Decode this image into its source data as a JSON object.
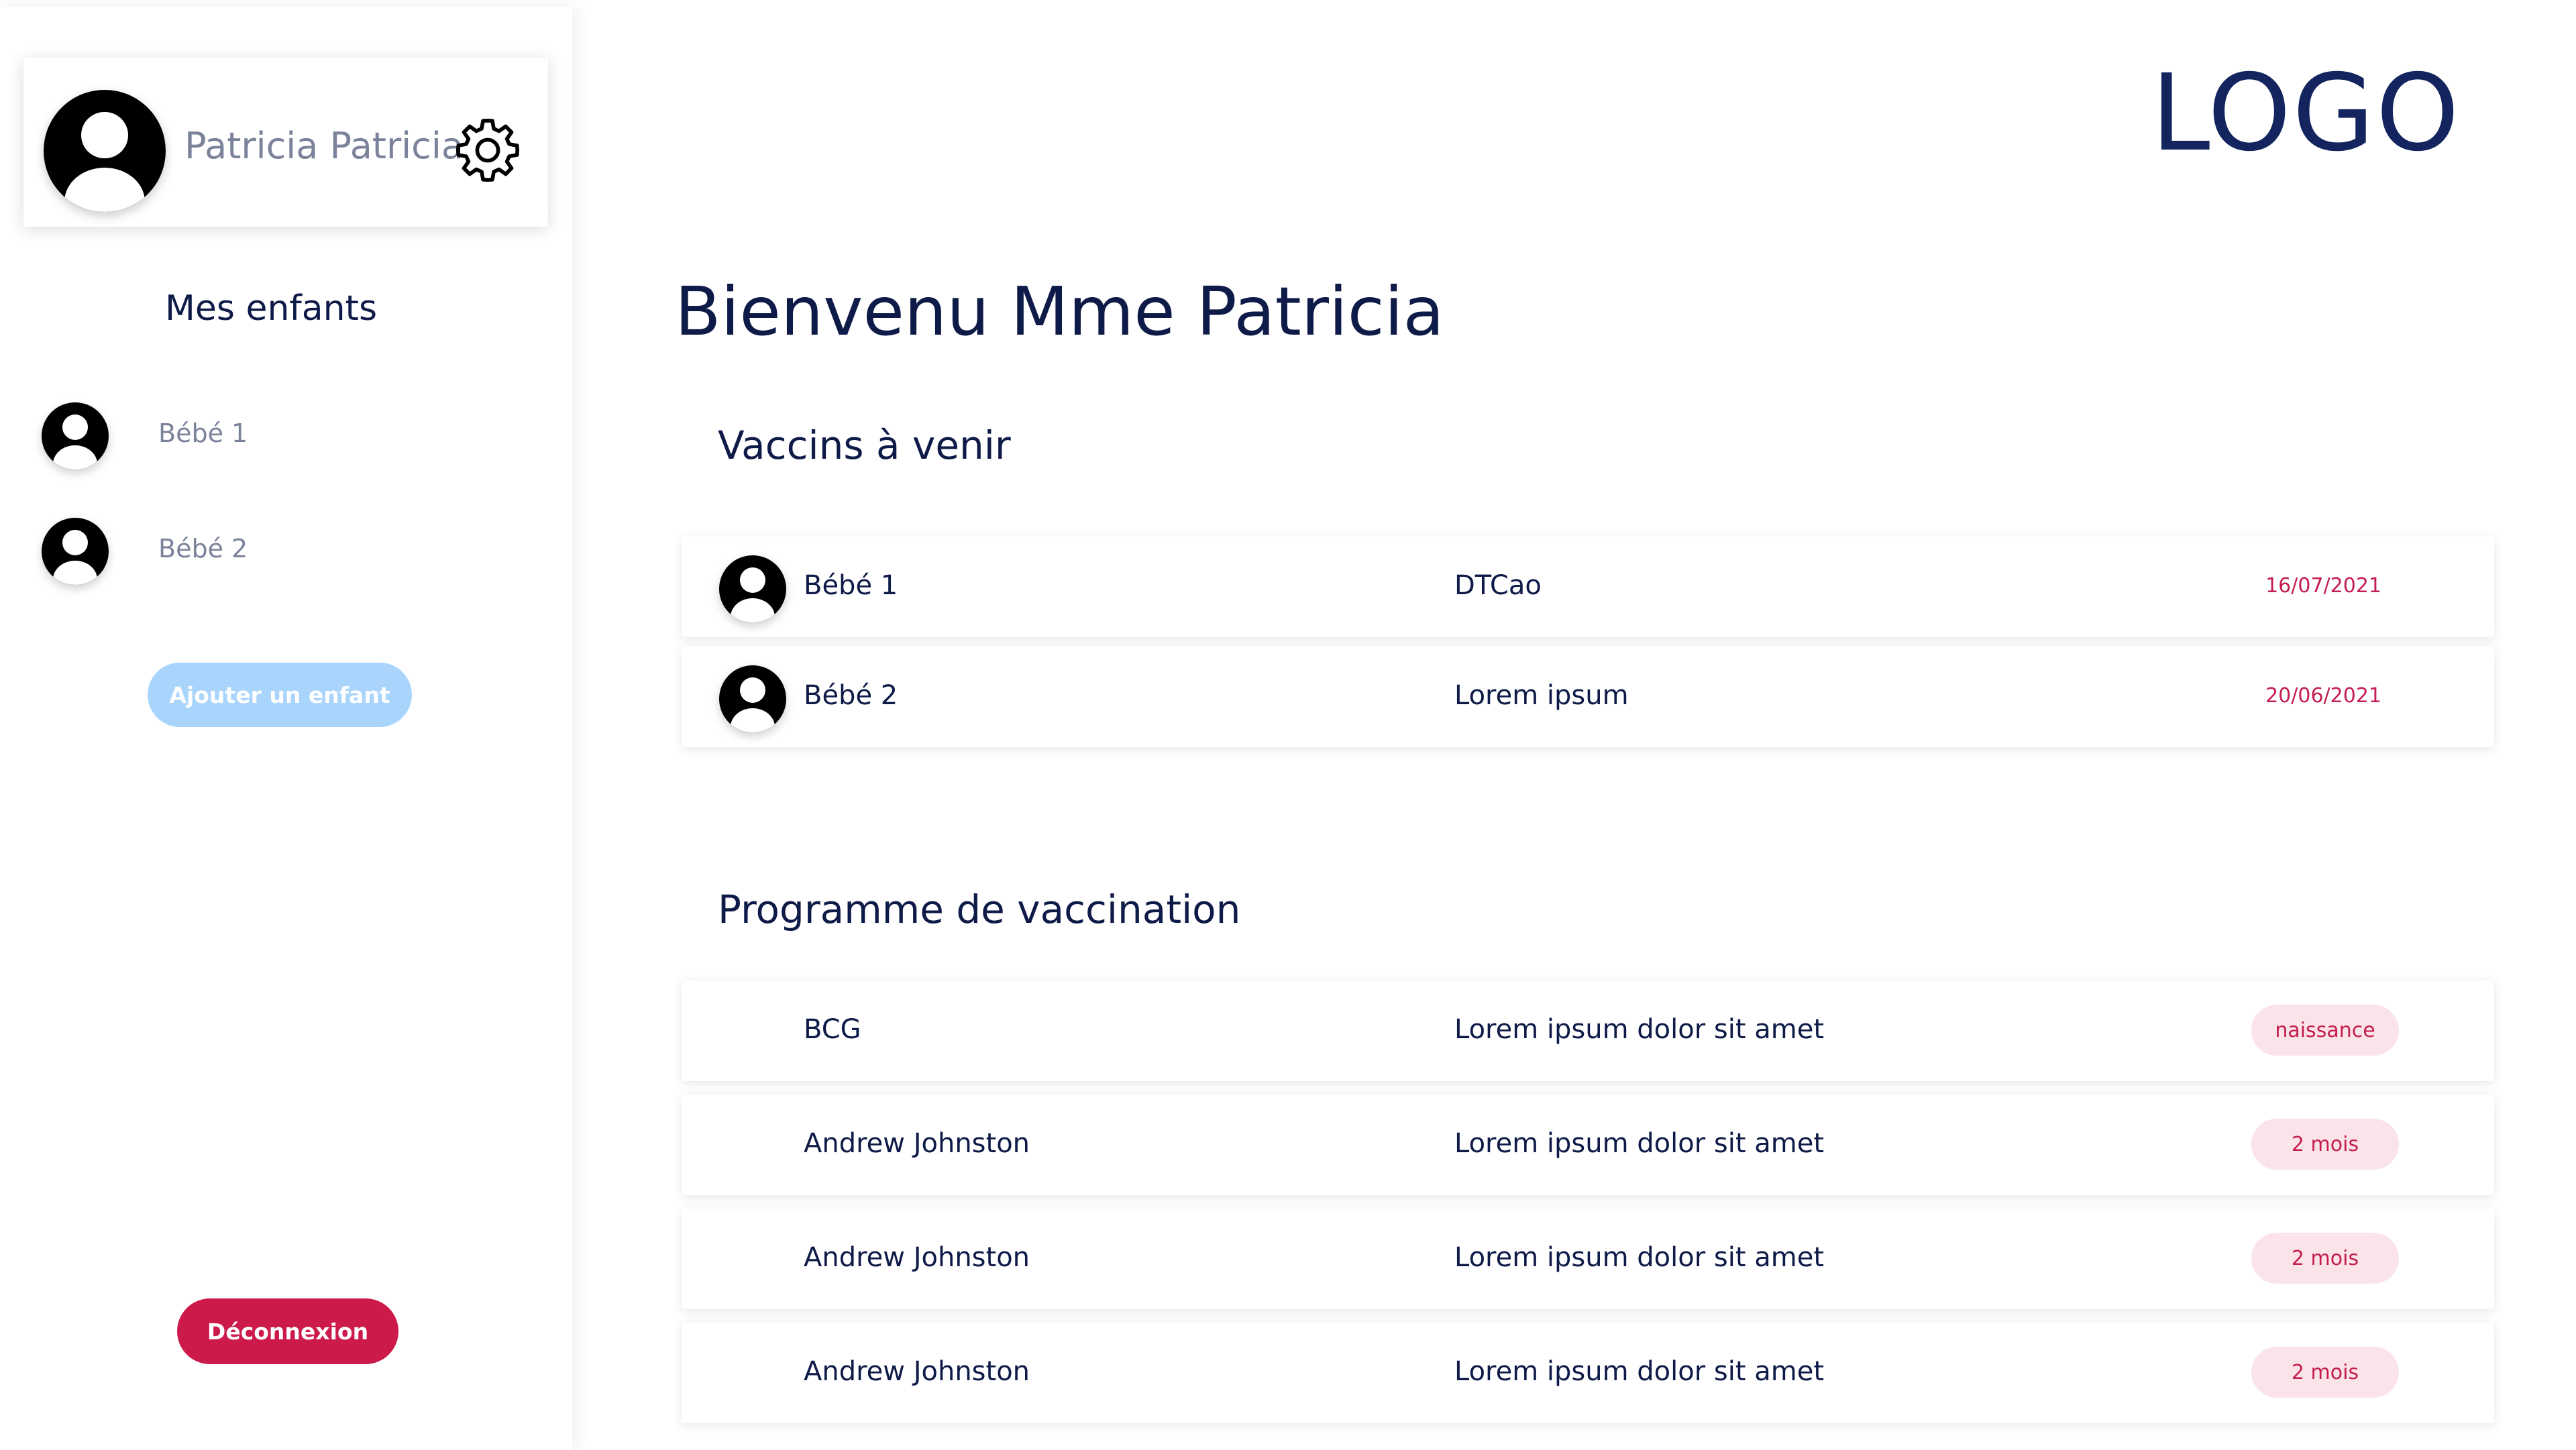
{
  "sidebar": {
    "profile": {
      "name": "Patricia Patricia",
      "avatar_icon": "user-avatar-icon",
      "settings_icon": "gear-icon"
    },
    "children_title": "Mes enfants",
    "children": [
      {
        "label": "Bébé 1",
        "icon": "user-avatar-icon"
      },
      {
        "label": "Bébé 2",
        "icon": "user-avatar-icon"
      }
    ],
    "add_child_label": "Ajouter un enfant",
    "logout_label": "Déconnexion"
  },
  "header": {
    "logo": "LOGO"
  },
  "main": {
    "title": "Bienvenu Mme Patricia",
    "upcoming": {
      "title": "Vaccins à venir",
      "rows": [
        {
          "child": "Bébé 1",
          "vaccine": "DTCao",
          "date": "16/07/2021",
          "icon": "user-avatar-icon"
        },
        {
          "child": "Bébé 2",
          "vaccine": "Lorem ipsum",
          "date": "20/06/2021",
          "icon": "user-avatar-icon"
        }
      ]
    },
    "program": {
      "title": "Programme de vaccination",
      "rows": [
        {
          "name": "BCG",
          "description": "Lorem ipsum dolor sit amet",
          "age": "naissance"
        },
        {
          "name": "Andrew Johnston",
          "description": "Lorem ipsum dolor sit amet",
          "age": "2 mois"
        },
        {
          "name": "Andrew Johnston",
          "description": "Lorem ipsum dolor sit amet",
          "age": "2 mois"
        },
        {
          "name": "Andrew Johnston",
          "description": "Lorem ipsum dolor sit amet",
          "age": "2 mois"
        }
      ]
    }
  },
  "colors": {
    "primary_text": "#0e1a47",
    "muted_text": "#7b839b",
    "accent_red": "#cc1a4a",
    "badge_bg": "#fbe3ea",
    "add_button_bg": "#a9d4fc",
    "logo": "#13245e"
  }
}
